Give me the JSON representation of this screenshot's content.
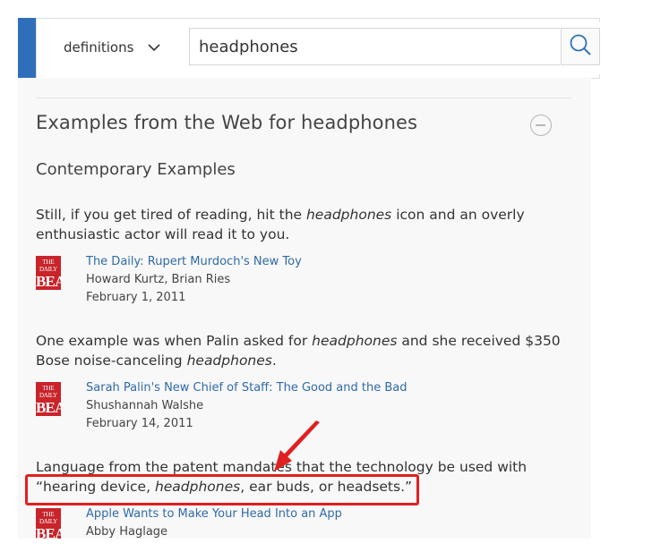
{
  "search": {
    "dictionary_label": "definitions",
    "query": "headphones",
    "chevron_icon": "chevron-down-icon",
    "search_icon": "search-icon"
  },
  "section": {
    "title": "Examples from the Web for headphones",
    "collapse_icon": "minus-circle-icon",
    "subhead": "Contemporary Examples"
  },
  "examples": [
    {
      "quote_parts": [
        "Still, if you get tired of reading, hit the ",
        "headphones",
        " icon and an overly enthusiastic actor will read it to you."
      ],
      "logo_top": "THE DAILY",
      "logo_bottom": "BEAST",
      "title": "The Daily: Rupert Murdoch's New Toy",
      "author": "Howard Kurtz, Brian Ries",
      "date": "February 1, 2011"
    },
    {
      "quote_parts": [
        "One example was when Palin asked for ",
        "headphones",
        " and she received $350 Bose noise-canceling ",
        "headphones",
        "."
      ],
      "logo_top": "THE DAILY",
      "logo_bottom": "BEAST",
      "title": "Sarah Palin's New Chief of Staff: The Good and the Bad",
      "author": "Shushannah Walshe",
      "date": "February 14, 2011"
    },
    {
      "quote_line1": "Language from the patent mandates that the technology be used with",
      "quote_line2_parts": [
        "“hearing device, ",
        "headphones",
        ", ear buds, or headsets.”"
      ],
      "logo_top": "THE DAILY",
      "logo_bottom": "BEAST",
      "title": "Apple Wants to Make Your Head Into an App",
      "author": "Abby Haglage"
    }
  ],
  "annotation": {
    "color": "#e02020"
  },
  "colors": {
    "header_blue": "#2f6fba",
    "link_blue": "#2f6aa8",
    "logo_red": "#c8242a"
  }
}
